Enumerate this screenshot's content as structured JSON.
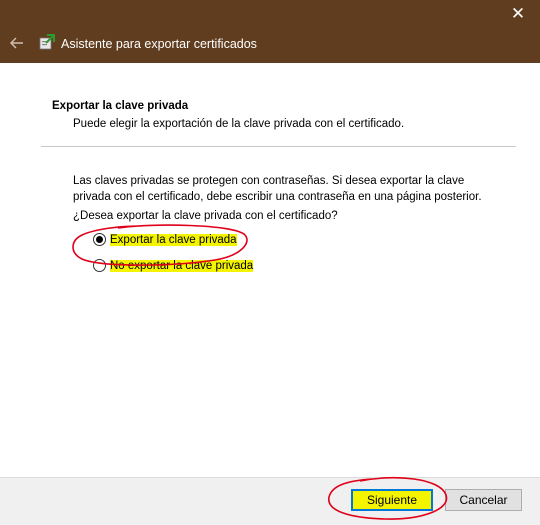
{
  "window": {
    "title": "Asistente para exportar certificados",
    "close_icon": "close-icon",
    "back_icon": "back-arrow-icon",
    "app_icon": "certificate-wizard-icon"
  },
  "header": {
    "section_title": "Exportar la clave privada",
    "section_subtitle": "Puede elegir la exportación de la clave privada con el certificado."
  },
  "body": {
    "description": "Las claves privadas se protegen con contraseñas. Si desea exportar la clave privada con el certificado, debe escribir una contraseña en una página posterior.",
    "question": "¿Desea exportar la clave privada con el certificado?",
    "options": [
      {
        "label": "Exportar la clave privada",
        "selected": true
      },
      {
        "label": "No exportar la clave privada",
        "selected": false
      }
    ]
  },
  "footer": {
    "next_label": "Siguiente",
    "cancel_label": "Cancelar"
  },
  "colors": {
    "titlebar": "#5f3d1e",
    "highlight": "#f4f400",
    "annotation_red": "#e0001a",
    "focus_blue": "#0078d7"
  }
}
